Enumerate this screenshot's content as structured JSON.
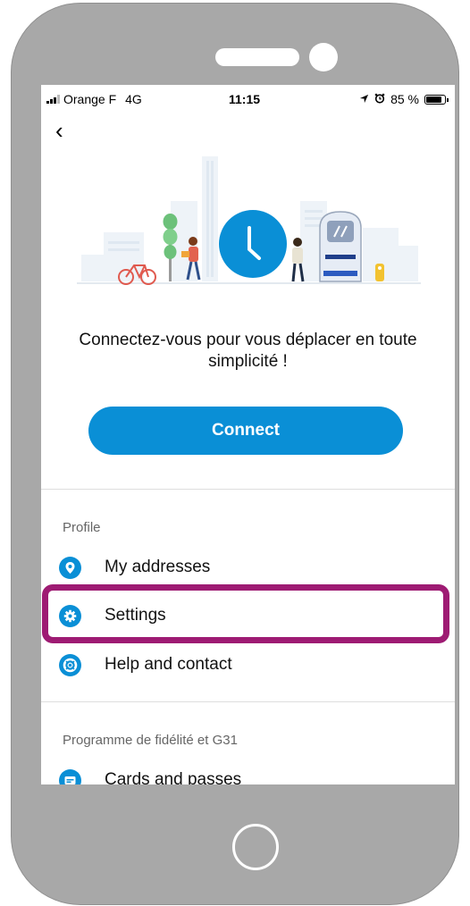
{
  "status_bar": {
    "carrier": "Orange F",
    "network": "4G",
    "time": "11:15",
    "battery": "85 %"
  },
  "header": {
    "back_icon": "chevron-left-icon",
    "back_glyph": "‹"
  },
  "hero": {
    "message": "Connectez-vous pour vous déplacer en toute simplicité !",
    "connect_label": "Connect"
  },
  "profile": {
    "section_label": "Profile",
    "items": [
      {
        "label": "My addresses",
        "icon": "location-pin-icon"
      },
      {
        "label": "Settings",
        "icon": "gear-icon"
      },
      {
        "label": "Help and contact",
        "icon": "lifebuoy-icon"
      }
    ]
  },
  "loyalty": {
    "section_label": "Programme de fidélité et G31",
    "items": [
      {
        "label": "Cards and passes",
        "icon": "card-icon"
      }
    ]
  },
  "colors": {
    "accent": "#0a8fd6",
    "highlight": "#9e1b73",
    "device": "#a8a8a8"
  }
}
